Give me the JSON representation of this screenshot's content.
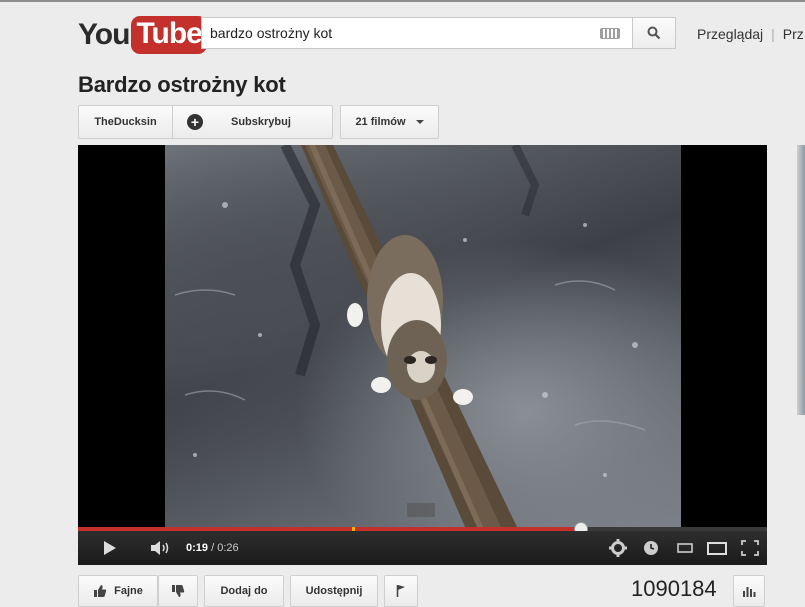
{
  "header": {
    "logo_you": "You",
    "logo_tube": "Tube",
    "search_value": "bardzo ostrożny kot",
    "nav_browse": "Przeglądaj",
    "nav_next": "Prz"
  },
  "video": {
    "title": "Bardzo ostrożny kot",
    "channel": "TheDucksin",
    "subscribe_label": "Subskrybuj",
    "videos_count_label": "21 filmów",
    "time_current": "0:19",
    "time_separator": "/",
    "time_total": "0:26",
    "progress_fraction": 0.73,
    "views": "1090184"
  },
  "actions": {
    "like_label": "Fajne",
    "add_to_label": "Dodaj do",
    "share_label": "Udostępnij"
  },
  "colors": {
    "brand_red": "#c4302b",
    "progress_red": "#c4302b",
    "ad_marker": "#f2b100"
  },
  "icons": [
    "search-icon",
    "keyboard-icon",
    "plus-icon",
    "chevron-down-icon",
    "play-icon",
    "volume-icon",
    "gear-icon",
    "clock-icon",
    "small-player-icon",
    "large-player-icon",
    "fullscreen-icon",
    "thumbs-up-icon",
    "thumbs-down-icon",
    "flag-icon",
    "stats-icon"
  ]
}
